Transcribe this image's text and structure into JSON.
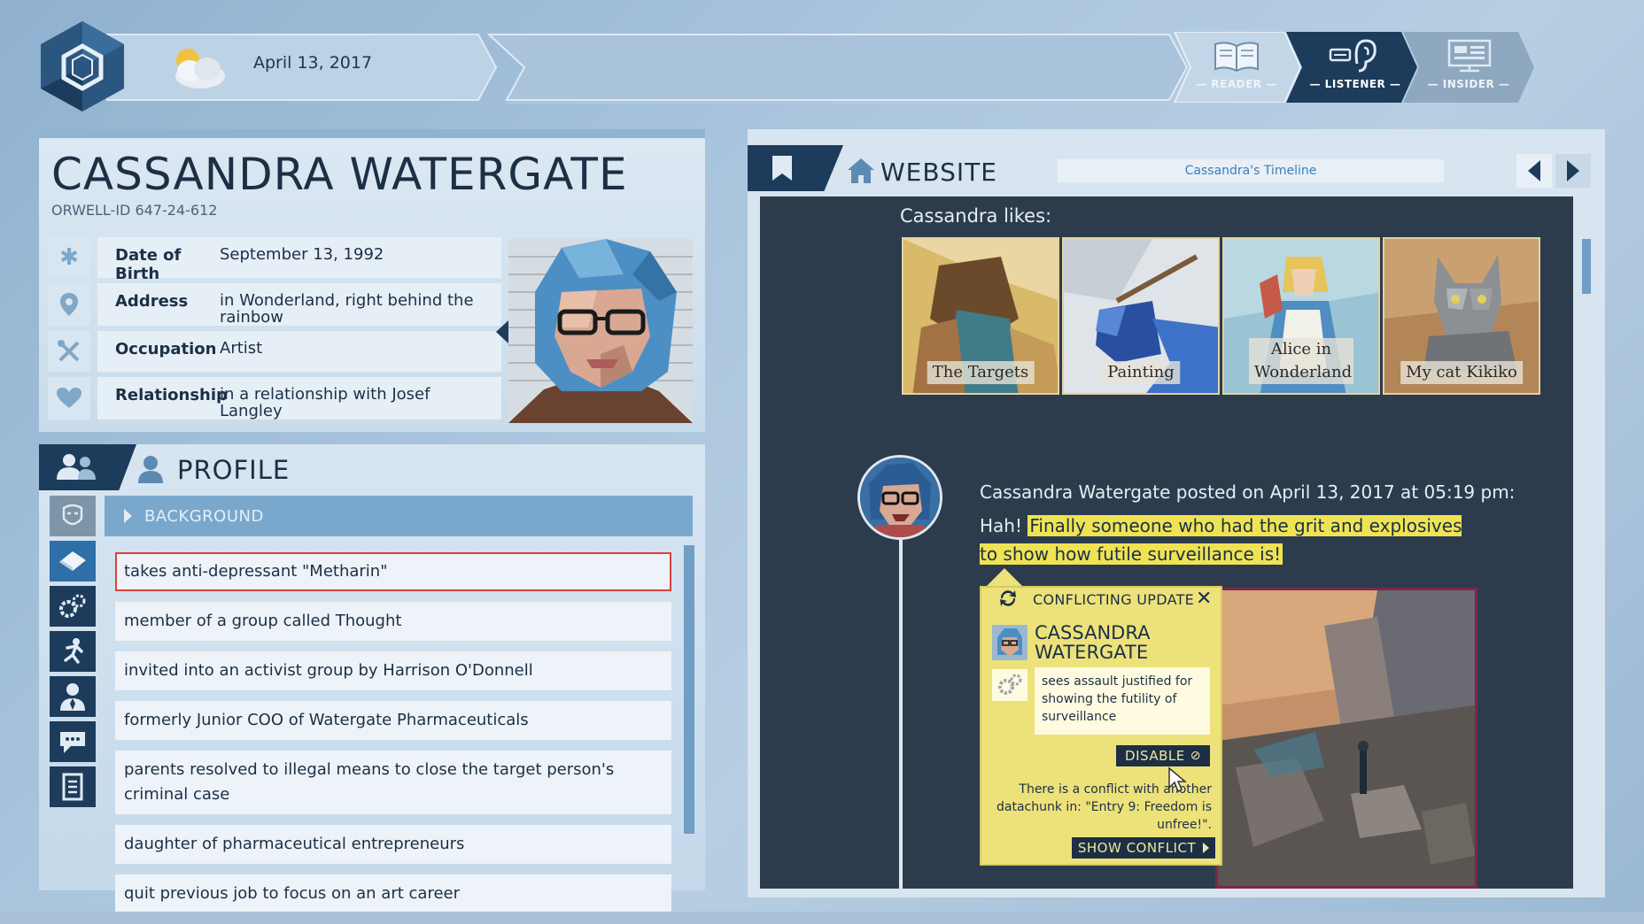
{
  "header": {
    "date": "April 13, 2017",
    "weather_icon": "partly-cloudy-icon",
    "modes": [
      {
        "label": "— READER —",
        "icon": "book-icon",
        "active": false
      },
      {
        "label": "— LISTENER —",
        "icon": "ear-icon",
        "active": true
      },
      {
        "label": "— INSIDER —",
        "icon": "monitor-icon",
        "active": false
      }
    ]
  },
  "person": {
    "name": "CASSANDRA WATERGATE",
    "orwell_id": "ORWELL-ID  647-24-612",
    "fields": [
      {
        "key": "Date of Birth",
        "value": "September 13, 1992",
        "icon": "asterisk-icon"
      },
      {
        "key": "Address",
        "value": "in Wonderland, right behind the rainbow",
        "icon": "location-pin-icon"
      },
      {
        "key": "Occupation",
        "value": "Artist",
        "icon": "tools-icon"
      },
      {
        "key": "Relationship",
        "value": "in a relationship with Josef Langley",
        "icon": "heart-icon"
      }
    ]
  },
  "profile": {
    "title": "PROFILE",
    "section": "BACKGROUND",
    "items": [
      "takes anti-depressant \"Metharin\"",
      "member of a group called Thought",
      "invited into an activist group by Harrison O'Donnell",
      "formerly Junior COO of Watergate Pharmaceuticals",
      "parents resolved to illegal means to close the target person's criminal case",
      "daughter of pharmaceutical entrepreneurs",
      "quit previous job to focus on an art career"
    ],
    "selected_index": 0,
    "side_icons": [
      "face-icon",
      "pill-icon",
      "gears-icon",
      "running-icon",
      "person-tie-icon",
      "chat-icon",
      "document-icon"
    ]
  },
  "website": {
    "title": "WEBSITE",
    "timeline_label": "Cassandra's Timeline",
    "likes_title": "Cassandra likes:",
    "likes": [
      "The Targets",
      "Painting",
      "Alice in Wonderland",
      "My cat Kikiko"
    ],
    "post": {
      "header": "Cassandra Watergate posted on April 13, 2017 at 05:19 pm:",
      "prefix": "Hah! ",
      "highlight": "Finally someone who had the grit and explosives to show how futile surveillance is!"
    },
    "conflict": {
      "title": "CONFLICTING UPDATE",
      "name": "CASSANDRA WATERGATE",
      "note": "sees assault justified for showing the futility of surveillance",
      "disable_label": "DISABLE",
      "message": "There is a conflict with another datachunk in: \"Entry 9: Freedom is unfree!\".",
      "show_label": "SHOW CONFLICT"
    }
  },
  "colors": {
    "navy": "#1d3b5a",
    "accent_blue": "#7aa8cc",
    "highlight_yellow": "#efe354",
    "conflict_yellow": "#ede27a",
    "selection_red": "#d9423a"
  }
}
